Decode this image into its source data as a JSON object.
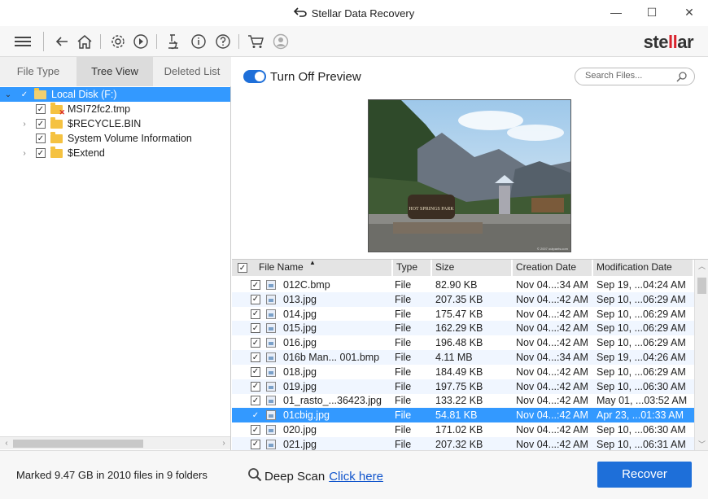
{
  "window": {
    "title": "Stellar Data Recovery",
    "minimize": "—",
    "maximize": "☐",
    "close": "✕"
  },
  "toolbar": {
    "logo_prefix": "ste",
    "logo_bars": "ll",
    "logo_suffix": "ar"
  },
  "left_tabs": [
    {
      "label": "File Type",
      "active": false
    },
    {
      "label": "Tree View",
      "active": true
    },
    {
      "label": "Deleted List",
      "active": false
    }
  ],
  "tree": [
    {
      "label": "Local Disk (F:)",
      "checked": true,
      "expander": "⌄",
      "level": 0,
      "selected": true
    },
    {
      "label": "MSI72fc2.tmp",
      "checked": true,
      "expander": "",
      "level": 1,
      "deleted": true
    },
    {
      "label": "$RECYCLE.BIN",
      "checked": true,
      "expander": "›",
      "level": 1
    },
    {
      "label": "System Volume Information",
      "checked": true,
      "expander": "",
      "level": 1
    },
    {
      "label": "$Extend",
      "checked": true,
      "expander": "›",
      "level": 1
    }
  ],
  "preview": {
    "toggle_label": "Turn Off Preview",
    "toggle_on": true,
    "sign_text": "HOT SPRINGS PARK",
    "watermark": "© 2007 outpants.com"
  },
  "search": {
    "placeholder": "Search Files..."
  },
  "table": {
    "headers": {
      "name": "File Name",
      "type": "Type",
      "size": "Size",
      "created": "Creation Date",
      "modified": "Modification Date"
    },
    "rows": [
      {
        "name": "012C.bmp",
        "type": "File",
        "size": "82.90 KB",
        "created": "Nov 04...:34 AM",
        "modified": "Sep 19, ...04:24 AM"
      },
      {
        "name": "013.jpg",
        "type": "File",
        "size": "207.35 KB",
        "created": "Nov 04...:42 AM",
        "modified": "Sep 10, ...06:29 AM"
      },
      {
        "name": "014.jpg",
        "type": "File",
        "size": "175.47 KB",
        "created": "Nov 04...:42 AM",
        "modified": "Sep 10, ...06:29 AM"
      },
      {
        "name": "015.jpg",
        "type": "File",
        "size": "162.29 KB",
        "created": "Nov 04...:42 AM",
        "modified": "Sep 10, ...06:29 AM"
      },
      {
        "name": "016.jpg",
        "type": "File",
        "size": "196.48 KB",
        "created": "Nov 04...:42 AM",
        "modified": "Sep 10, ...06:29 AM"
      },
      {
        "name": "016b Man... 001.bmp",
        "type": "File",
        "size": "4.11 MB",
        "created": "Nov 04...:34 AM",
        "modified": "Sep 19, ...04:26 AM"
      },
      {
        "name": "018.jpg",
        "type": "File",
        "size": "184.49 KB",
        "created": "Nov 04...:42 AM",
        "modified": "Sep 10, ...06:29 AM"
      },
      {
        "name": "019.jpg",
        "type": "File",
        "size": "197.75 KB",
        "created": "Nov 04...:42 AM",
        "modified": "Sep 10, ...06:30 AM"
      },
      {
        "name": "01_rasto_...36423.jpg",
        "type": "File",
        "size": "133.22 KB",
        "created": "Nov 04...:42 AM",
        "modified": "May 01, ...03:52 AM"
      },
      {
        "name": "01cbig.jpg",
        "type": "File",
        "size": "54.81 KB",
        "created": "Nov 04...:42 AM",
        "modified": "Apr 23, ...01:33 AM",
        "selected": true
      },
      {
        "name": "020.jpg",
        "type": "File",
        "size": "171.02 KB",
        "created": "Nov 04...:42 AM",
        "modified": "Sep 10, ...06:30 AM"
      },
      {
        "name": "021.jpg",
        "type": "File",
        "size": "207.32 KB",
        "created": "Nov 04...:42 AM",
        "modified": "Sep 10, ...06:31 AM"
      }
    ]
  },
  "status": {
    "marked": "Marked 9.47 GB in 2010 files in 9 folders",
    "deep_scan_label": "Deep Scan",
    "deep_scan_link": "Click here",
    "recover": "Recover"
  },
  "colors": {
    "accent": "#1e6fd9",
    "selection": "#3399ff",
    "logo_red": "#d9232d"
  }
}
